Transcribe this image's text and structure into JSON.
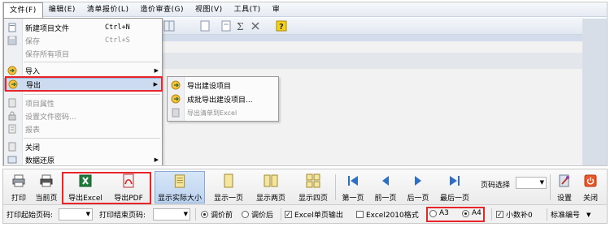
{
  "menubar": {
    "items": [
      "文件(F)",
      "编辑(E)",
      "清单报价(L)",
      "造价审查(G)",
      "视图(V)",
      "工具(T)",
      "审"
    ]
  },
  "file_menu": {
    "new_project": {
      "label": "新建项目文件",
      "shortcut": "Ctrl+N"
    },
    "save": {
      "label": "保存",
      "shortcut": "Ctrl+S"
    },
    "save_all": {
      "label": "保存所有项目"
    },
    "import": {
      "label": "导入"
    },
    "export": {
      "label": "导出"
    },
    "project_properties": {
      "label": "项目属性"
    },
    "set_password": {
      "label": "设置文件密码..."
    },
    "report": {
      "label": "报表"
    },
    "close": {
      "label": "关闭"
    },
    "data_restore": {
      "label": "数据还原"
    }
  },
  "export_submenu": {
    "export_project": "导出建设项目",
    "batch_export": "成批导出建设项目...",
    "export_excel": "导出清单到Excel"
  },
  "print_toolbar": {
    "print": "打印",
    "current_page": "当前页",
    "export_excel": "导出Excel",
    "export_pdf": "导出PDF",
    "actual_size": "显示实际大小",
    "one_page": "显示一页",
    "two_pages": "显示两页",
    "four_pages": "显示四页",
    "first_page": "第一页",
    "prev_page": "前一页",
    "next_page": "后一页",
    "last_page": "最后一页",
    "page_select_label": "页码选择",
    "settings": "设置",
    "close": "关闭"
  },
  "options_row": {
    "start_page_label": "打印起始页码:",
    "end_page_label": "打印结束页码:",
    "before_adjust": "调价前",
    "after_adjust": "调价后",
    "excel_single_page": "Excel单页输出",
    "excel_2010": "Excel2010格式",
    "paper_a3": "A3",
    "paper_a4": "A4",
    "decimal_pad": "小数补0",
    "numbering": "标准编号"
  },
  "colors": {
    "annotation_red": "#e8262a",
    "menu_highlight": "#ccdbef",
    "pressed_button": "#bcd3ef",
    "nav_blue": "#2f6fc2"
  }
}
